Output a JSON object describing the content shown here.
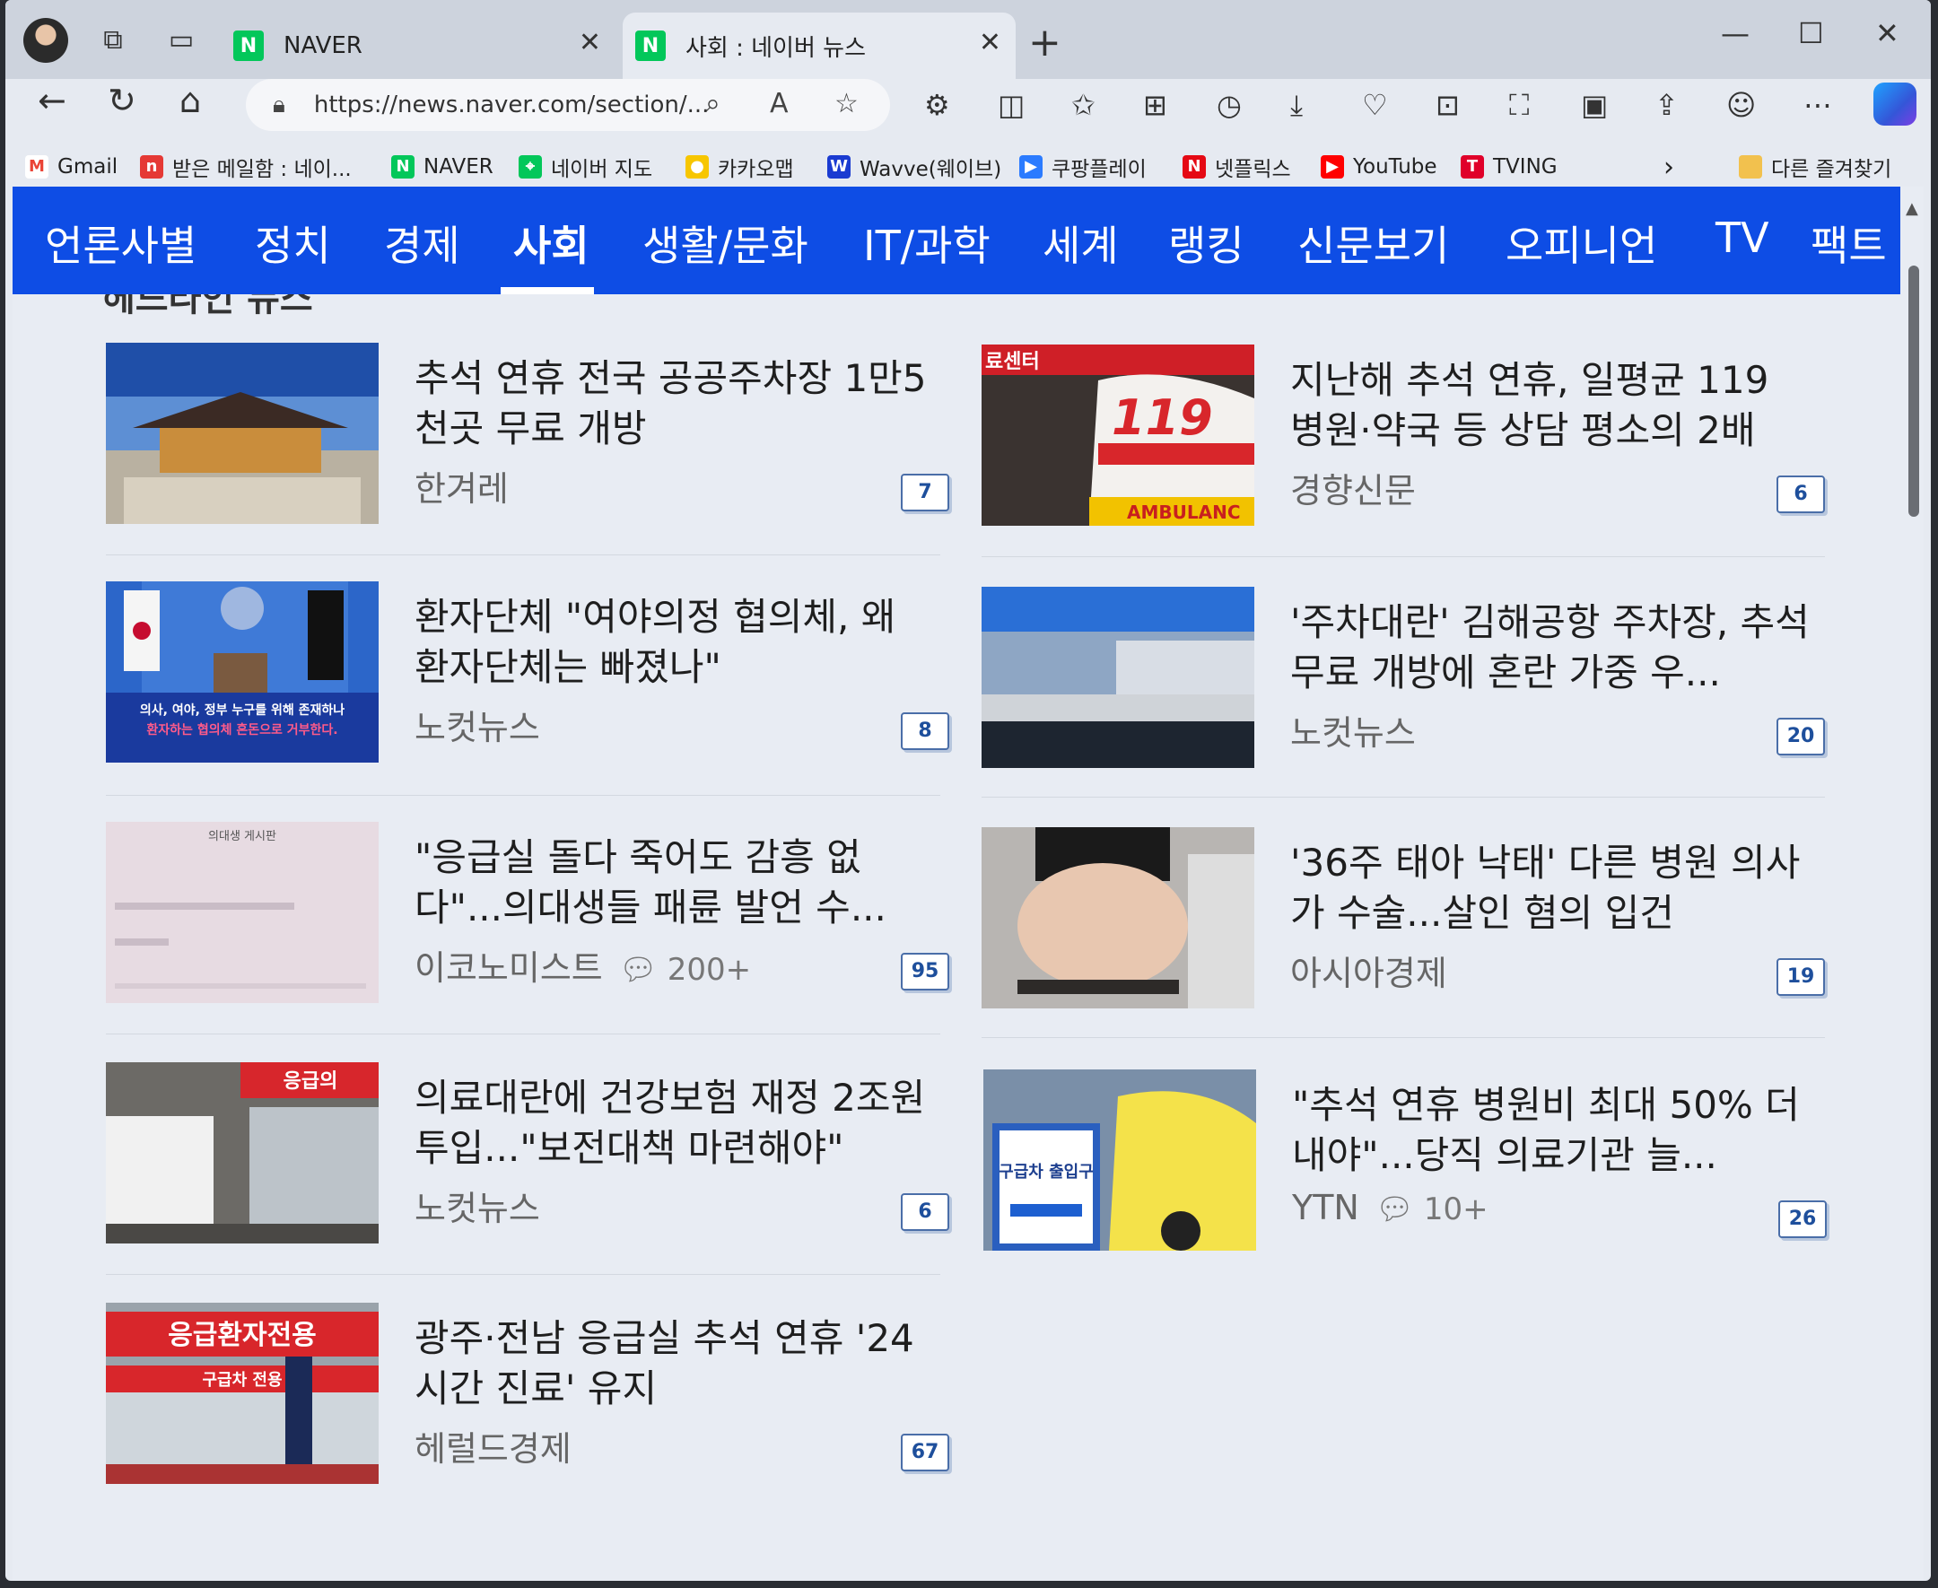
{
  "browser": {
    "tabs": [
      {
        "label": "NAVER"
      },
      {
        "label": "사회 : 네이버 뉴스"
      }
    ],
    "address_url": "https://news.naver.com/section/...",
    "bookmarks": [
      {
        "label": "Gmail",
        "color": "#ea4335",
        "glyph": "M"
      },
      {
        "label": "받은 메일함 : 네이...",
        "color": "#e53935",
        "glyph": "n"
      },
      {
        "label": "NAVER",
        "color": "#03c75a",
        "glyph": "N"
      },
      {
        "label": "네이버 지도",
        "color": "#03c75a",
        "glyph": "⌖"
      },
      {
        "label": "카카오맵",
        "color": "#f7c600",
        "glyph": "●"
      },
      {
        "label": "Wavve(웨이브)",
        "color": "#1a3bd1",
        "glyph": "W"
      },
      {
        "label": "쿠팡플레이",
        "color": "#2b7bff",
        "glyph": "▶"
      },
      {
        "label": "넷플릭스",
        "color": "#e50914",
        "glyph": "N"
      },
      {
        "label": "YouTube",
        "color": "#ff0000",
        "glyph": "▶"
      },
      {
        "label": "TVING",
        "color": "#e0002a",
        "glyph": "T"
      }
    ],
    "other_bookmarks": "다른 즐겨찾기"
  },
  "section_heading_partial": "헤드라인 뉴스",
  "nav": {
    "items": [
      "언론사별",
      "정치",
      "경제",
      "사회",
      "생활/문화",
      "IT/과학",
      "세계",
      "랭킹",
      "신문보기",
      "오피니언",
      "TV",
      "팩트"
    ],
    "selected": "사회"
  },
  "articles": [
    {
      "title": "추석 연휴 전국 공공주차장 1만5천곳 무료 개방",
      "press": "한겨레",
      "comments": "",
      "count": "7"
    },
    {
      "title": "지난해 추석 연휴, 일평균 119 병원·약국 등 상담 평소의 2배",
      "press": "경향신문",
      "comments": "",
      "count": "6"
    },
    {
      "title": "환자단체 \"여야의정 협의체, 왜 환자단체는 빠졌나\"",
      "press": "노컷뉴스",
      "comments": "",
      "count": "8"
    },
    {
      "title": "'주차대란' 김해공항 주차장, 추석 무료 개방에 혼란 가중 우...",
      "press": "노컷뉴스",
      "comments": "",
      "count": "20"
    },
    {
      "title": "\"응급실 돌다 죽어도 감흥 없다\"...의대생들 패륜 발언 수...",
      "press": "이코노미스트",
      "comments": "200+",
      "count": "95"
    },
    {
      "title": "'36주 태아 낙태' 다른 병원 의사가 수술...살인 혐의 입건",
      "press": "아시아경제",
      "comments": "",
      "count": "19"
    },
    {
      "title": "의료대란에 건강보험 재정 2조원 투입...\"보전대책 마련해야\"",
      "press": "노컷뉴스",
      "comments": "",
      "count": "6"
    },
    {
      "title": "\"추석 연휴 병원비 최대 50% 더 내야\"...당직 의료기관 늘...",
      "press": "YTN",
      "comments": "10+",
      "count": "26"
    },
    {
      "title": "광주·전남 응급실 추석 연휴 '24시간 진료' 유지",
      "press": "헤럴드경제",
      "comments": "",
      "count": "67"
    }
  ],
  "thumbnail_texts": {
    "ambulance_119": "119",
    "ambulance_sign": "AMBULANC",
    "er_center": "료센터",
    "ambulance_entrance": "구급차 출입구",
    "er_banner": "응급의",
    "gwangju_sign": "응급환자전용",
    "gwangju_sub": "구급차 전용",
    "board_title": "의대생 게시판",
    "banner_line1": "의사, 여야, 정부 누구를 위해 존재하나",
    "banner_line2": "환자하는 협의체 혼돈으로 거부한다."
  },
  "colors": {
    "naver_blue": "#0e4de5",
    "naver_green": "#03c75a"
  }
}
